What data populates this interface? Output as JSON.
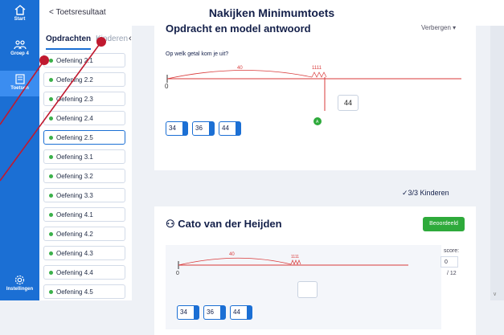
{
  "rail": {
    "items": [
      {
        "label": "Start",
        "icon": "home-icon"
      },
      {
        "label": "Groep 4",
        "icon": "group-icon"
      },
      {
        "label": "Toetsen",
        "icon": "document-icon"
      },
      {
        "label": "Instellingen",
        "icon": "gear-icon"
      }
    ]
  },
  "header": {
    "back_label": "< Toetsresultaat",
    "title": "Nakijken Minimumtoets"
  },
  "panel": {
    "tab_active": "Opdrachten",
    "tab_inactive": "Kinderen",
    "items": [
      "Oefening 2.1",
      "Oefening 2.2",
      "Oefening 2.3",
      "Oefening 2.4",
      "Oefening 2.5",
      "Oefening 3.1",
      "Oefening 3.2",
      "Oefening 3.3",
      "Oefening 4.1",
      "Oefening 4.2",
      "Oefening 4.3",
      "Oefening 4.4",
      "Oefening 4.5"
    ],
    "selected_index": 4
  },
  "model": {
    "heading": "Opdracht en model antwoord",
    "toggle": "Verbergen",
    "question": "Op welk getal kom je uit?",
    "line_start": "0",
    "arc_label": "40",
    "ticks_label": "1111",
    "answer": "44",
    "marker": "A",
    "choices": [
      "34",
      "36",
      "44"
    ]
  },
  "kids_count": "3/3 Kinderen",
  "student": {
    "name": "Cato van der Heijden",
    "status": "Beoordeeld",
    "line_start": "0",
    "arc_label": "40",
    "ticks_label": "1111",
    "choices": [
      "34",
      "36",
      "44"
    ],
    "score_label": "score:",
    "score_value": "0",
    "score_total": "/ 12"
  },
  "colors": {
    "primary": "#1b6fd4",
    "success": "#2eaa3b",
    "numberline": "#d93a3a",
    "annotation": "#c0192f"
  }
}
